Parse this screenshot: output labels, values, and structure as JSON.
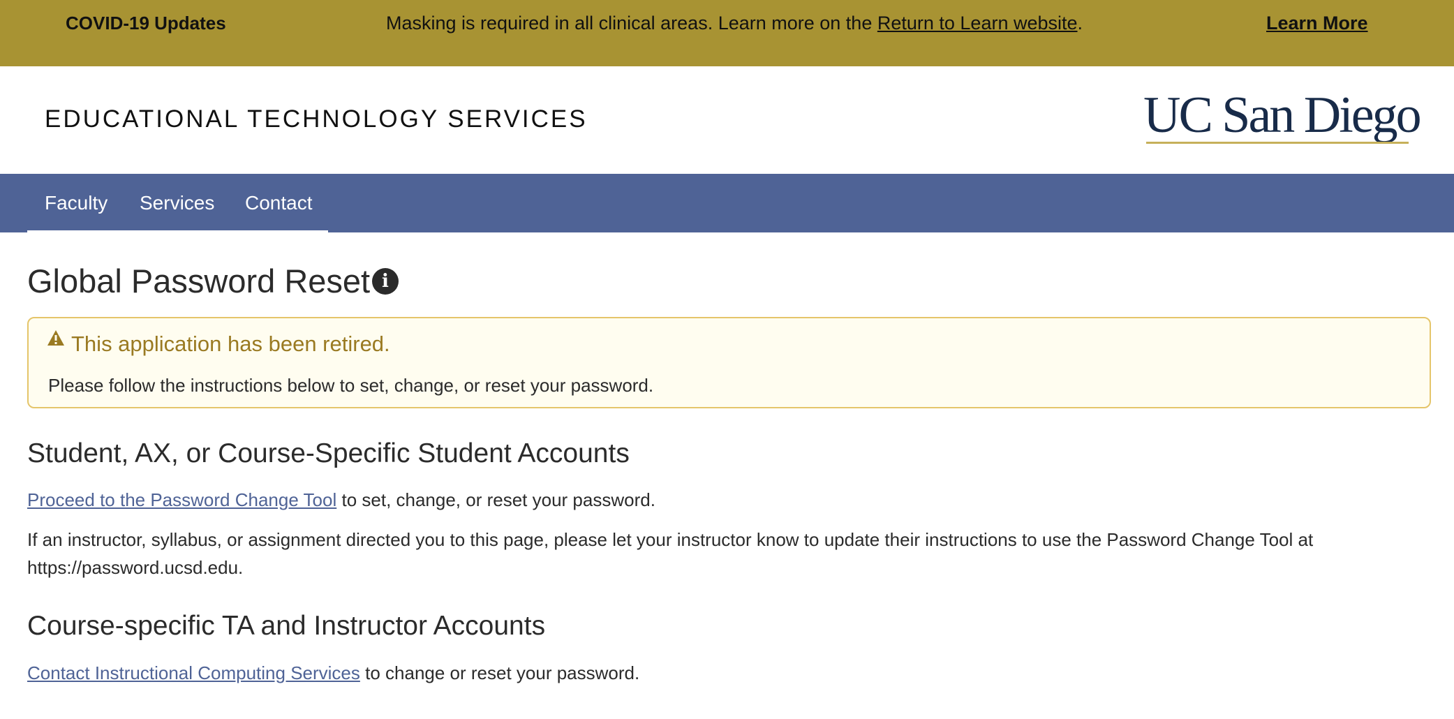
{
  "covid_banner": {
    "title": "COVID-19 Updates",
    "message_prefix": "Masking is required in all clinical areas. Learn more on the ",
    "message_link": "Return to Learn website",
    "message_suffix": ".",
    "learn_more": "Learn More",
    "background_color": "#a89333"
  },
  "header": {
    "site_name": "EDUCATIONAL TECHNOLOGY SERVICES",
    "logo_text": "UC San Diego",
    "logo_color": "#182b49"
  },
  "nav": {
    "items": [
      {
        "label": "Faculty"
      },
      {
        "label": "Services"
      },
      {
        "label": "Contact"
      }
    ],
    "background_color": "#4f6396"
  },
  "main": {
    "title": "Global Password Reset",
    "title_icon": "info-icon",
    "alert": {
      "icon": "warning-icon",
      "title": "This application has been retired.",
      "body": "Please follow the instructions below to set, change, or reset your password."
    },
    "student_section": {
      "heading": "Student, AX, or Course-Specific Student Accounts",
      "link_text": "Proceed to the Password Change Tool",
      "link_suffix": " to set, change, or reset your password.",
      "note": "If an instructor, syllabus, or assignment directed you to this page, please let your instructor know to update their instructions to use the Password Change Tool at https://password.ucsd.edu."
    },
    "ta_section": {
      "heading": "Course-specific TA and Instructor Accounts",
      "link_text": "Contact Instructional Computing Services",
      "link_suffix": " to change or reset your password."
    }
  }
}
